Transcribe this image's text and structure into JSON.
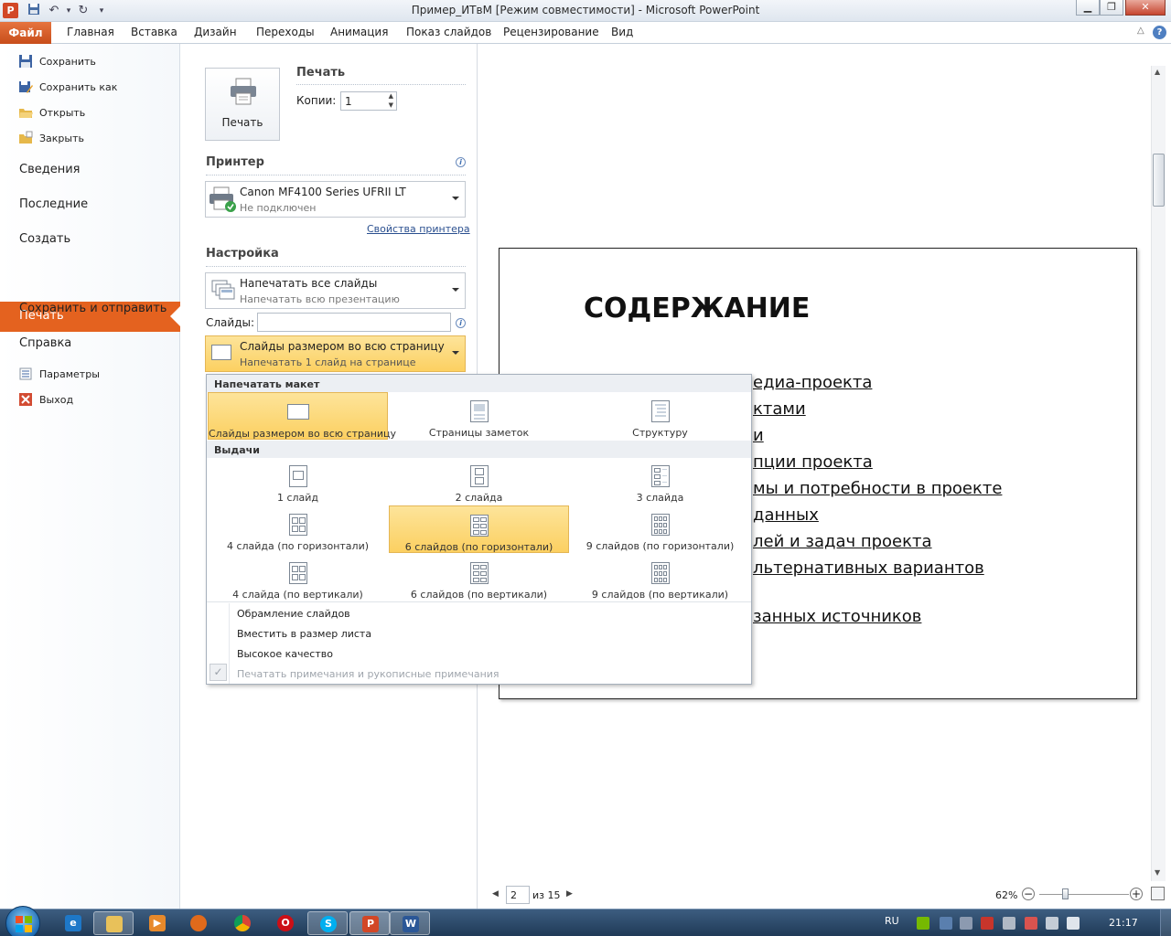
{
  "window": {
    "title": "Пример_ИТвМ [Режим совместимости]  -  Microsoft PowerPoint",
    "app_icon": "P",
    "controls": [
      "minimize-icon",
      "maximize-icon",
      "close-icon"
    ]
  },
  "ribbon": {
    "file_tab": "Файл",
    "tabs": [
      "Главная",
      "Вставка",
      "Дизайн",
      "Переходы",
      "Анимация",
      "Показ слайдов",
      "Рецензирование",
      "Вид"
    ]
  },
  "nav": {
    "save": "Сохранить",
    "save_as": "Сохранить как",
    "open": "Открыть",
    "close": "Закрыть",
    "info": "Сведения",
    "recent": "Последние",
    "create": "Создать",
    "print": "Печать",
    "save_send": "Сохранить и отправить",
    "help": "Справка",
    "options": "Параметры",
    "exit": "Выход"
  },
  "print": {
    "button_label": "Печать",
    "heading": "Печать",
    "copies_label": "Копии:",
    "copies_value": "1"
  },
  "printer": {
    "heading": "Принтер",
    "name": "Canon MF4100 Series UFRII LT",
    "status": "Не подключен",
    "properties_link": "Свойства принтера"
  },
  "settings": {
    "heading": "Настройка",
    "range_main": "Напечатать все слайды",
    "range_sub": "Напечатать всю презентацию",
    "slides_label": "Слайды:",
    "slides_value": "",
    "layout_main": "Слайды размером во всю страницу",
    "layout_sub": "Напечатать 1 слайд на странице"
  },
  "dropdown": {
    "layout_heading": "Напечатать макет",
    "layout_options": [
      "Слайды размером во всю страницу",
      "Страницы заметок",
      "Структуру"
    ],
    "handouts_heading": "Выдачи",
    "handout_options": [
      "1 слайд",
      "2 слайда",
      "3 слайда",
      "4 слайда (по горизонтали)",
      "6 слайдов (по горизонтали)",
      "9 слайдов (по горизонтали)",
      "4 слайда (по вертикали)",
      "6 слайдов (по вертикали)",
      "9 слайдов (по вертикали)"
    ],
    "toggles": {
      "frame": "Обрамление слайдов",
      "fit": "Вместить в размер листа",
      "quality": "Высокое качество",
      "comments": "Печатать примечания и рукописные примечания"
    }
  },
  "slide": {
    "title": "СОДЕРЖАНИЕ",
    "items": [
      "едиа-проекта",
      "ктами",
      "и",
      "пции проекта",
      "мы и потребности в проекте",
      "данных",
      "лей и задач проекта",
      "льтернативных вариантов",
      "занных источников"
    ]
  },
  "status": {
    "page_current": "2",
    "page_total": "из 15",
    "zoom": "62%"
  },
  "taskbar": {
    "language": "RU",
    "clock": "21:17"
  },
  "colors": {
    "file_tab": "#d9622a",
    "nav_active": "#e4621f",
    "selection": "#fcd061"
  }
}
